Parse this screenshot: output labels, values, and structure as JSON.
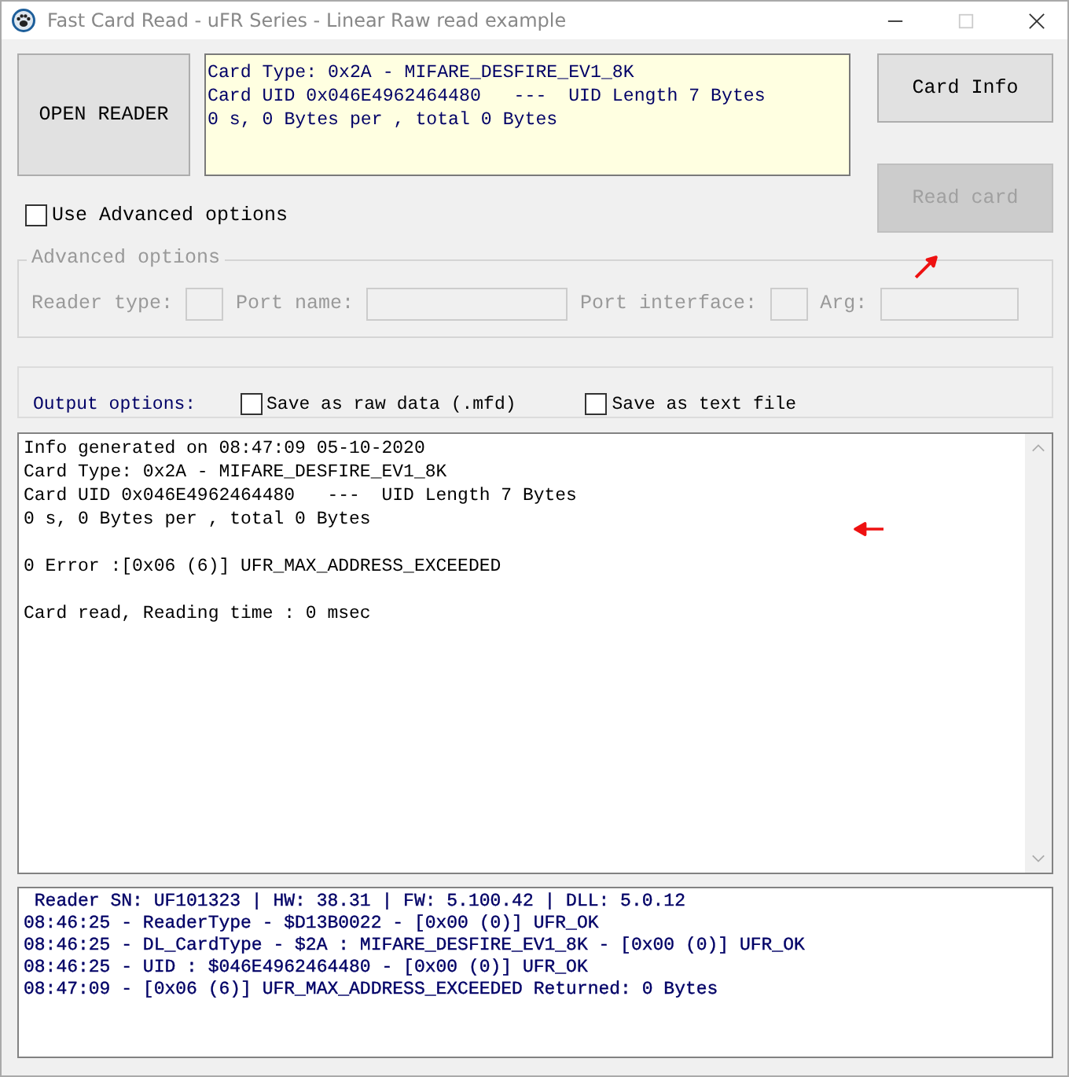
{
  "window": {
    "title": "Fast Card Read - uFR Series - Linear Raw read example",
    "maximize_disabled": true
  },
  "open_reader_button": {
    "label": "OPEN READER",
    "disabled": false
  },
  "card_summary": [
    "Card Type: 0x2A - MIFARE_DESFIRE_EV1_8K",
    "Card UID 0x046E4962464480   ---  UID Length 7 Bytes",
    "0 s, 0 Bytes per , total 0 Bytes"
  ],
  "card_info_button": {
    "label": "Card Info",
    "disabled": false
  },
  "read_card_button": {
    "label": "Read card",
    "disabled": true
  },
  "use_advanced": {
    "label": "Use Advanced options",
    "checked": false
  },
  "advanced_options": {
    "title": "Advanced options",
    "disabled": true,
    "fields": [
      {
        "label": "Reader type:",
        "kind": "short"
      },
      {
        "label": "Port name:",
        "kind": "wide"
      },
      {
        "label": "Port interface:",
        "kind": "short"
      },
      {
        "label": "Arg:",
        "kind": "wide"
      }
    ]
  },
  "output_options": {
    "label": "Output options:",
    "options": [
      {
        "label": "Save as raw data (.mfd)",
        "checked": false
      },
      {
        "label": "Save as text file",
        "checked": false
      }
    ]
  },
  "output_blocks": [
    [
      "Info generated on 08:47:09 05-10-2020",
      "Card Type: 0x2A - MIFARE_DESFIRE_EV1_8K",
      "Card UID 0x046E4962464480   ---  UID Length 7 Bytes",
      "0 s, 0 Bytes per , total 0 Bytes"
    ],
    [
      "0 Error :[0x06 (6)] UFR_MAX_ADDRESS_EXCEEDED"
    ],
    [
      "Card read, Reading time : 0 msec"
    ]
  ],
  "log_lines": [
    " Reader SN: UF101323 | HW: 38.31 | FW: 5.100.42 | DLL: 5.0.12",
    "08:46:25 - ReaderType - $D13B0022 - [0x00 (0)] UFR_OK",
    "08:46:25 - DL_CardType - $2A : MIFARE_DESFIRE_EV1_8K - [0x00 (0)] UFR_OK",
    "08:46:25 - UID : $046E4962464480 - [0x00 (0)] UFR_OK",
    "08:47:09 - [0x06 (6)] UFR_MAX_ADDRESS_EXCEEDED Returned: 0 Bytes"
  ]
}
